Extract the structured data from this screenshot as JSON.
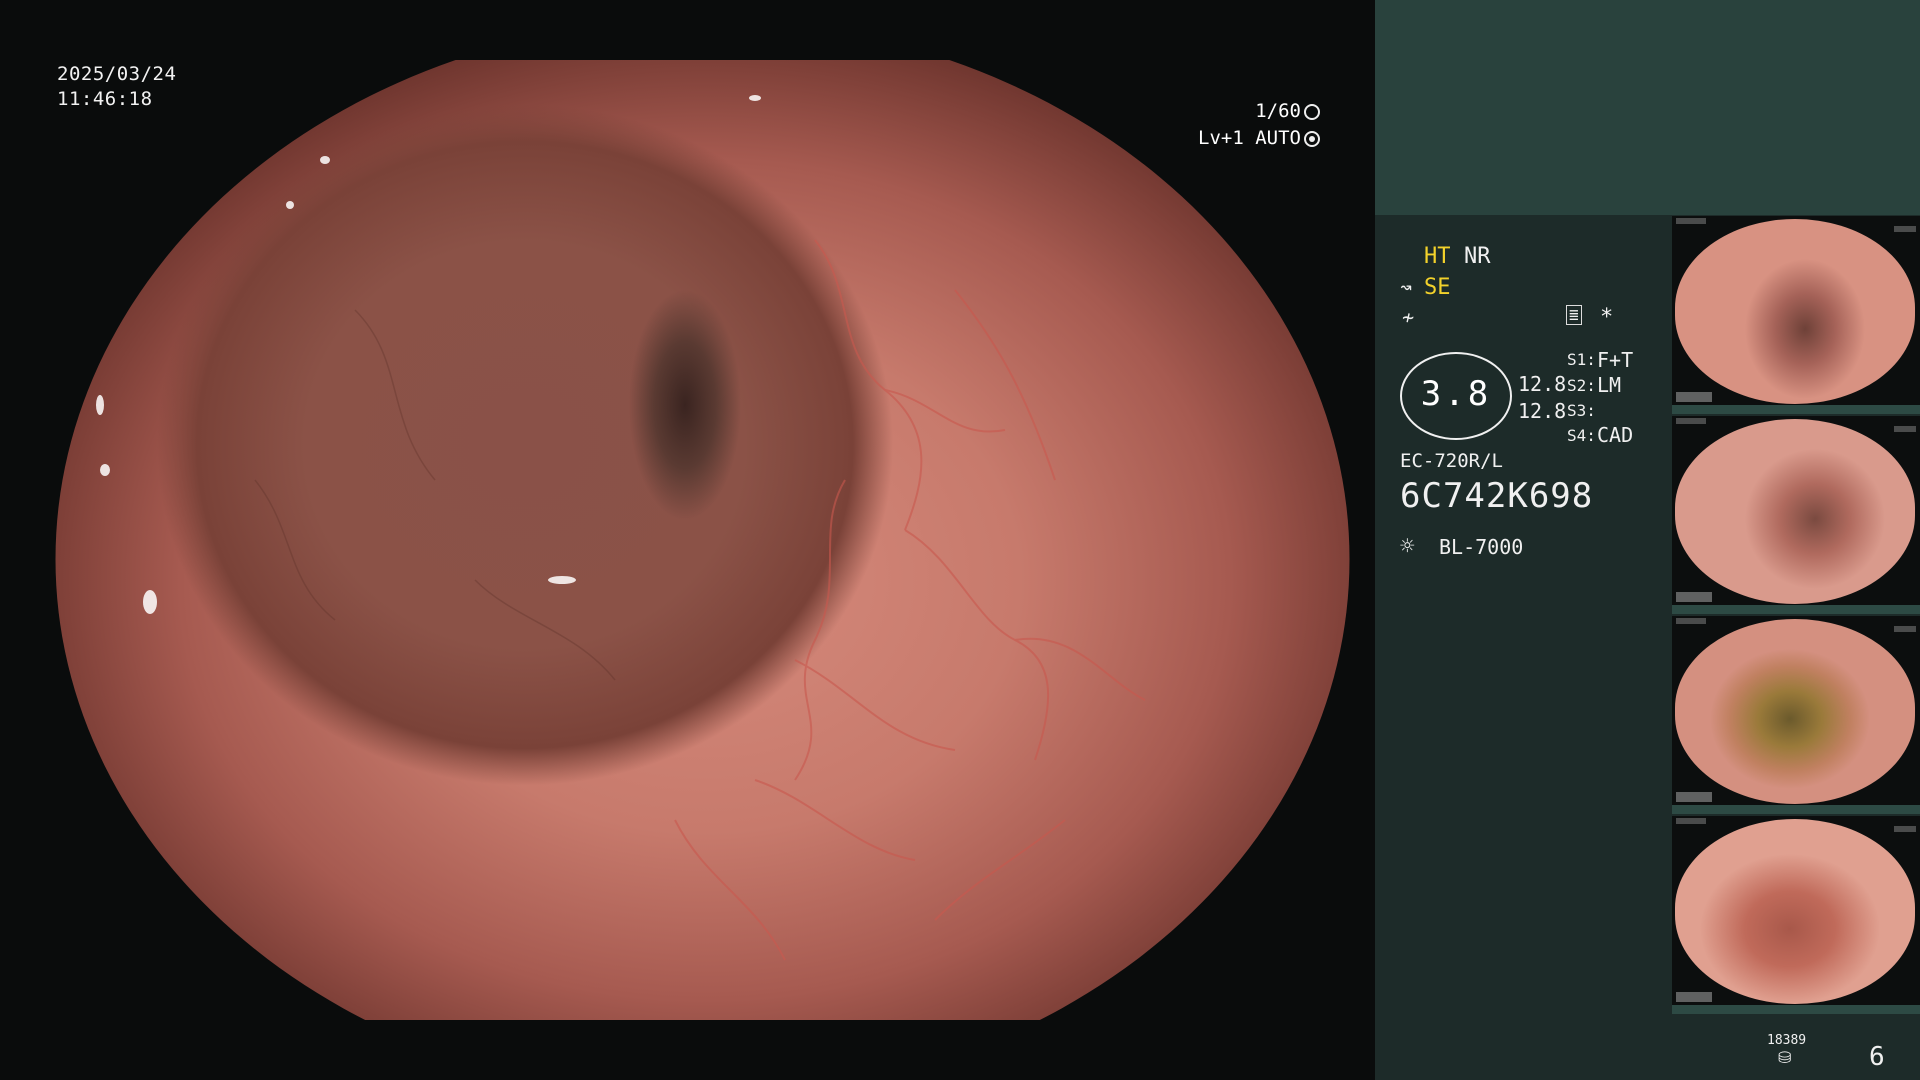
{
  "overlay": {
    "date": "2025/03/24",
    "time": "11:46:18",
    "shutter": "1/60",
    "level": "Lv+1 AUTO"
  },
  "settings": {
    "ht": "HT",
    "nr": "NR",
    "se": "SE",
    "gauge_value": "3.8",
    "val1": "12.8",
    "val2": "12.8",
    "s1_label": "S1:",
    "s1_value": "F+T",
    "s2_label": "S2:",
    "s2_value": "LM",
    "s3_label": "S3:",
    "s3_value": "",
    "s4_label": "S4:",
    "s4_value": "CAD",
    "scope_model": "EC-720R/L",
    "serial": "6C742K698",
    "light_source": "BL-7000"
  },
  "storage": {
    "count": "18389",
    "image_count": "6"
  },
  "colors": {
    "sidebar_bg": "#1d2b29",
    "sidebar_header": "#29423d",
    "accent_yellow": "#f3d22b"
  },
  "icons": {
    "shutter": "aperture-icon",
    "level": "iris-icon",
    "light": "sun-icon",
    "storage": "disk-stack-icon"
  }
}
